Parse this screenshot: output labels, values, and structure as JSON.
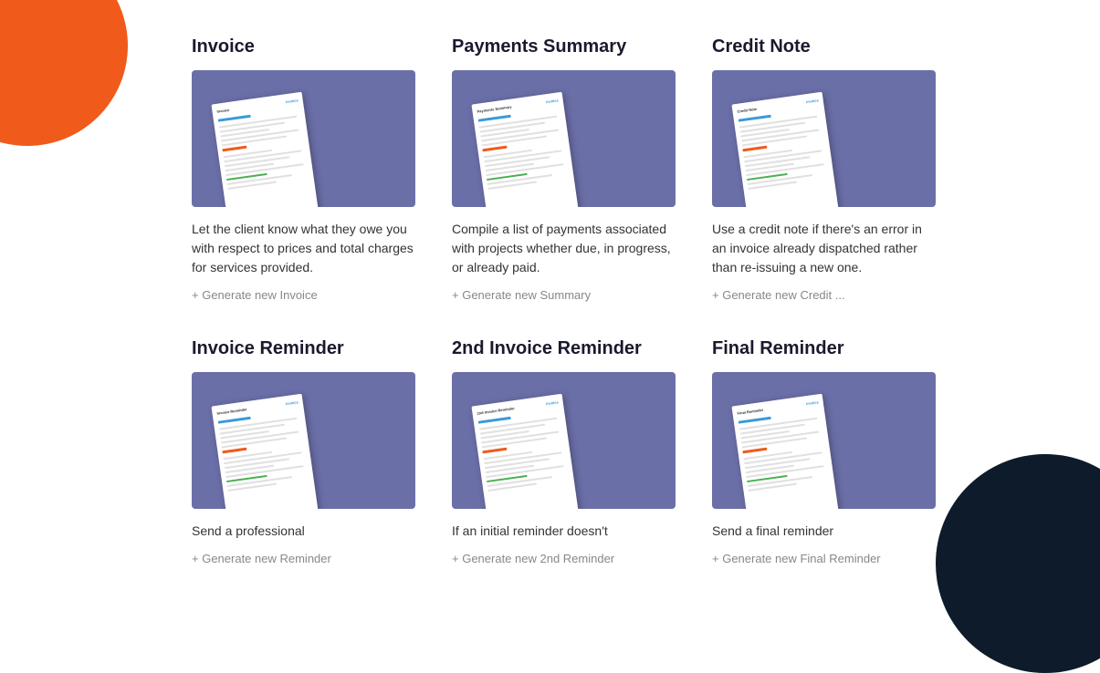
{
  "blobs": {
    "orange": "orange-blob",
    "dark": "dark-blob"
  },
  "cards": [
    {
      "id": "invoice",
      "title": "Invoice",
      "description": "Let the client know what they owe you with respect to prices and total charges for services provided.",
      "action": "+ Generate new Invoice",
      "doc_type": "invoice"
    },
    {
      "id": "payments-summary",
      "title": "Payments Summary",
      "description": "Compile a list of payments associated with projects whether due, in progress, or already paid.",
      "action": "+ Generate new Summary",
      "doc_type": "payments"
    },
    {
      "id": "credit-note",
      "title": "Credit Note",
      "description": "Use a credit note if there's an error in an invoice already dispatched rather than re-issuing a new one.",
      "action": "+ Generate new Credit ...",
      "doc_type": "credit"
    },
    {
      "id": "invoice-reminder",
      "title": "Invoice Reminder",
      "description": "Send a professional",
      "action": "+ Generate new Reminder",
      "doc_type": "reminder1"
    },
    {
      "id": "2nd-invoice-reminder",
      "title": "2nd Invoice Reminder",
      "description": "If an initial reminder doesn't",
      "action": "+ Generate new 2nd Reminder",
      "doc_type": "reminder2"
    },
    {
      "id": "final-reminder",
      "title": "Final Reminder",
      "description": "Send a final reminder",
      "action": "+ Generate new Final Reminder",
      "doc_type": "reminder3"
    }
  ]
}
